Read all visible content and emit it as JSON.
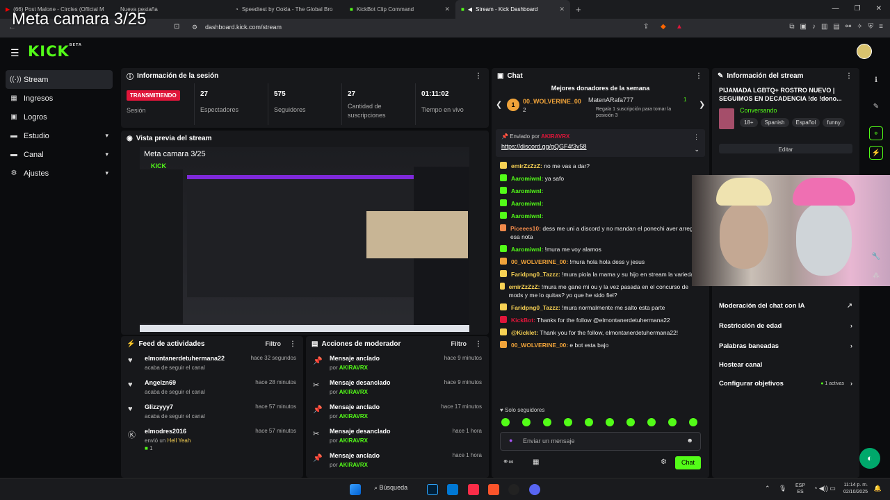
{
  "overlay_title": "Meta camara 3/25",
  "tabs": [
    {
      "label": "(66) Post Malone - Circles (Official M"
    },
    {
      "label": "Nueva pestaña"
    },
    {
      "label": "Speedtest by Ookla - The Global Bro"
    },
    {
      "label": "KickBot Clip Command"
    },
    {
      "label": "Stream - Kick Dashboard"
    }
  ],
  "url": "dashboard.kick.com/stream",
  "logo": "KICK",
  "logo_sup": "BETA",
  "sidebar": {
    "items": [
      {
        "label": "Stream",
        "icon": "stream-icon"
      },
      {
        "label": "Ingresos",
        "icon": "revenue-icon"
      },
      {
        "label": "Logros",
        "icon": "achievements-icon"
      },
      {
        "label": "Estudio",
        "icon": "studio-icon"
      },
      {
        "label": "Canal",
        "icon": "channel-icon"
      },
      {
        "label": "Ajustes",
        "icon": "settings-icon"
      }
    ]
  },
  "session": {
    "title": "Información de la sesión",
    "live_badge": "TRANSMITIENDO",
    "live_label": "Sesión",
    "stats": [
      {
        "value": "27",
        "label": "Espectadores"
      },
      {
        "value": "575",
        "label": "Seguidores"
      },
      {
        "value": "27",
        "label": "Cantidad de suscripciones"
      },
      {
        "value": "01:11:02",
        "label": "Tiempo en vivo"
      }
    ]
  },
  "preview": {
    "title": "Vista previa del stream",
    "overlay": "Meta camara 3/25"
  },
  "feed": {
    "title": "Feed de actividades",
    "filter": "Filtro",
    "rows": [
      {
        "name": "elmontanerdetuhermana22",
        "sub": "acaba de seguir el canal",
        "time": "hace 32 segundos"
      },
      {
        "name": "Angelzn69",
        "sub": "acaba de seguir el canal",
        "time": "hace 28 minutos"
      },
      {
        "name": "Glizzyyy7",
        "sub": "acaba de seguir el canal",
        "time": "hace 57 minutos"
      },
      {
        "name": "elmodres2016",
        "sub": "envió un",
        "sub2": "Hell Yeah",
        "count": "1",
        "time": "hace 57 minutos"
      }
    ]
  },
  "mod": {
    "title": "Acciones de moderador",
    "filter": "Filtro",
    "rows": [
      {
        "action": "Mensaje anclado",
        "by": "por",
        "user": "AKIRAVRX",
        "time": "hace 9 minutos"
      },
      {
        "action": "Mensaje desanclado",
        "by": "por",
        "user": "AKIRAVRX",
        "time": "hace 9 minutos"
      },
      {
        "action": "Mensaje anclado",
        "by": "por",
        "user": "AKIRAVRX",
        "time": "hace 17 minutos"
      },
      {
        "action": "Mensaje desanclado",
        "by": "por",
        "user": "AKIRAVRX",
        "time": "hace 1 hora"
      },
      {
        "action": "Mensaje anclado",
        "by": "por",
        "user": "AKIRAVRX",
        "time": "hace 1 hora"
      }
    ]
  },
  "chat": {
    "title": "Chat",
    "top_donors": "Mejores donadores de la semana",
    "donor1": "00_WOLVERINE_00",
    "donor1_count": "2",
    "donor2": "MatenARafa777",
    "donor2_count": "1",
    "donor_promo": "Regala 1 suscripción para tomar la posición 3",
    "pinned_by": "Enviado por",
    "pinned_user": "AKIRAVRX",
    "pinned_link": "https://discord.gg/gQGF4f3v58",
    "messages": [
      {
        "user": "emirZzZzZ:",
        "text": "no me vas a dar?",
        "color": "#f7d154"
      },
      {
        "user": "Aaromiwnl:",
        "text": "ya safo",
        "color": "#53fc18"
      },
      {
        "user": "Aaromiwnl:",
        "text": "",
        "color": "#53fc18"
      },
      {
        "user": "Aaromiwnl:",
        "text": "",
        "color": "#53fc18"
      },
      {
        "user": "Aaromiwnl:",
        "text": "",
        "color": "#53fc18"
      },
      {
        "user": "Piceees10:",
        "text": "dess me uni a discord y no mandan el ponechi aver arregla esa nota",
        "color": "#f08a4b"
      },
      {
        "user": "Aaromiwnl:",
        "text": "!mura me voy alamos",
        "color": "#53fc18"
      },
      {
        "user": "00_WOLVERINE_00:",
        "text": "!mura hola hola dess y jesus",
        "color": "#f0a33a"
      },
      {
        "user": "Faridpng0_Tazzz:",
        "text": "!mura piola la mama y su hijo en stream la variedad",
        "color": "#f7d154"
      },
      {
        "user": "emirZzZzZ:",
        "text": "!mura me gane mi ou y la vez pasada en el concurso de mods y me lo quitas? yo que he sido fiel?",
        "color": "#f7d154"
      },
      {
        "user": "Faridpng0_Tazzz:",
        "text": "!mura normalmente me salto esta parte",
        "color": "#f7d154"
      },
      {
        "user": "KickBot:",
        "text": "Thanks for the follow @elmontanerdetuhermana22",
        "color": "#e0163a"
      },
      {
        "user": "@Kicklet:",
        "text": "Thank you for the follow, elmontanerdetuhermana22!",
        "color": "#f7d154"
      },
      {
        "user": "00_WOLVERINE_00:",
        "text": "e bot esta bajo",
        "color": "#f0a33a"
      }
    ],
    "followers_only": "Solo seguidores",
    "input_placeholder": "Enviar un mensaje",
    "send": "Chat"
  },
  "stream_info": {
    "title": "Información del stream",
    "stream_title": "PIJAMADA LGBTQ+ ROSTRO NUEVO | SEGUIMOS EN DECADENCIA !dc !dono...",
    "category": "Conversando",
    "tags": [
      "18+",
      "Spanish",
      "Español",
      "funny"
    ],
    "edit": "Editar",
    "items": [
      {
        "label": "Moderación del chat con IA"
      },
      {
        "label": "Restricción de edad"
      },
      {
        "label": "Palabras baneadas"
      },
      {
        "label": "Hostear canal"
      },
      {
        "label": "Configurar objetivos",
        "extra": "1 activas"
      }
    ]
  },
  "taskbar": {
    "search": "Búsqueda",
    "lang": "ESP",
    "lang2": "ES",
    "time": "11:14 p. m.",
    "date": "02/10/2025"
  }
}
